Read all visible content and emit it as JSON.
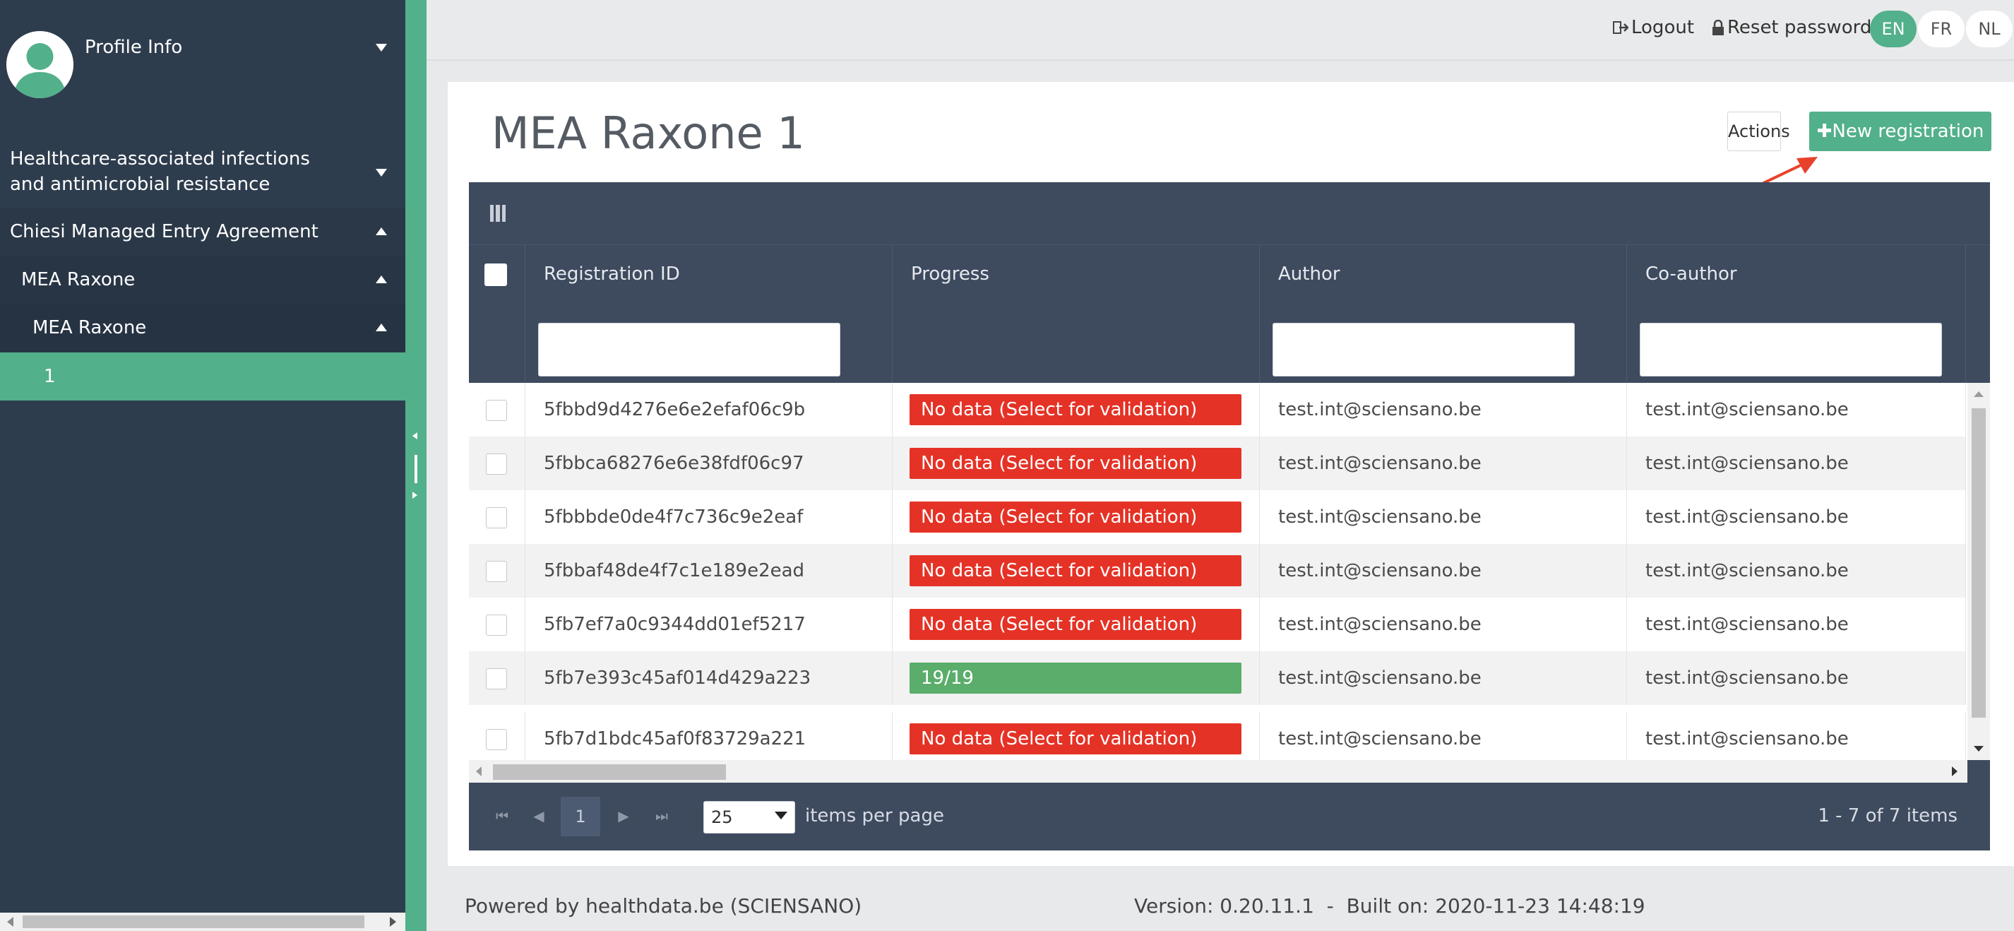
{
  "sidebar": {
    "profile_label": "Profile Info",
    "items": [
      {
        "label": "Healthcare-associated infections and antimicrobial resistance",
        "state": "collapsed"
      },
      {
        "label": "Chiesi Managed Entry Agreement",
        "state": "expanded"
      },
      {
        "label": "MEA Raxone",
        "state": "expanded"
      },
      {
        "label": "MEA Raxone",
        "state": "expanded"
      },
      {
        "label": "1",
        "state": "selected"
      }
    ]
  },
  "header": {
    "logout_label": "Logout",
    "reset_password_label": "Reset password",
    "languages": [
      "EN",
      "FR",
      "NL"
    ],
    "active_language": "EN"
  },
  "page": {
    "title": "MEA Raxone 1",
    "actions_label": "Actions",
    "new_registration_label": "New registration"
  },
  "grid": {
    "columns": [
      "Registration ID",
      "Progress",
      "Author",
      "Co-author"
    ],
    "rows": [
      {
        "id": "5fbbd9d4276e6e2efaf06c9b",
        "progress": "No data (Select for validation)",
        "status": "error",
        "author": "test.int@sciensano.be",
        "coauthor": "test.int@sciensano.be"
      },
      {
        "id": "5fbbca68276e6e38fdf06c97",
        "progress": "No data (Select for validation)",
        "status": "error",
        "author": "test.int@sciensano.be",
        "coauthor": "test.int@sciensano.be"
      },
      {
        "id": "5fbbbde0de4f7c736c9e2eaf",
        "progress": "No data (Select for validation)",
        "status": "error",
        "author": "test.int@sciensano.be",
        "coauthor": "test.int@sciensano.be"
      },
      {
        "id": "5fbbaf48de4f7c1e189e2ead",
        "progress": "No data (Select for validation)",
        "status": "error",
        "author": "test.int@sciensano.be",
        "coauthor": "test.int@sciensano.be"
      },
      {
        "id": "5fb7ef7a0c9344dd01ef5217",
        "progress": "No data (Select for validation)",
        "status": "error",
        "author": "test.int@sciensano.be",
        "coauthor": "test.int@sciensano.be"
      },
      {
        "id": "5fb7e393c45af014d429a223",
        "progress": "19/19",
        "status": "complete",
        "author": "test.int@sciensano.be",
        "coauthor": "test.int@sciensano.be"
      },
      {
        "id": "5fb7d1bdc45af0f83729a221",
        "progress": "No data (Select for validation)",
        "status": "error",
        "author": "test.int@sciensano.be",
        "coauthor": "test.int@sciensano.be"
      }
    ],
    "pager": {
      "current_page": "1",
      "page_size": "25",
      "items_per_page_label": "items per page",
      "info": "1 - 7 of 7 items"
    }
  },
  "footer": {
    "powered_by": "Powered by healthdata.be (SCIENSANO)",
    "version_info": "Version: 0.20.11.1  -  Built on: 2020-11-23 14:48:19"
  },
  "colors": {
    "brand_green": "#52b08a",
    "sidebar_bg": "#2e3d4e",
    "grid_header_bg": "#3e4a5e",
    "error_red": "#e53226",
    "success_green": "#5aad6a",
    "annotation_arrow": "#e8412b"
  }
}
